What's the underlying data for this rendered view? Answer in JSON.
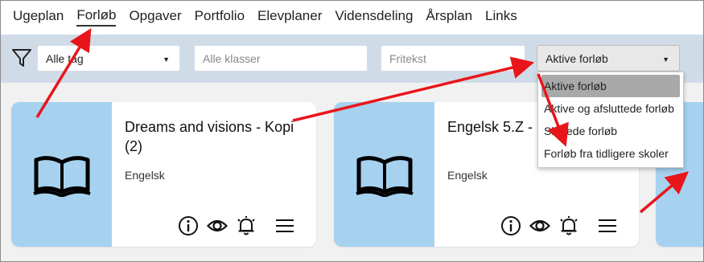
{
  "nav": {
    "items": [
      "Ugeplan",
      "Forløb",
      "Opgaver",
      "Portfolio",
      "Elevplaner",
      "Vidensdeling",
      "Årsplan",
      "Links"
    ],
    "active_index": 1
  },
  "filters": {
    "tags_select": "Alle tag",
    "classes_placeholder": "Alle klasser",
    "freetext_placeholder": "Fritekst",
    "status_select": "Aktive forløb"
  },
  "dropdown": {
    "options": [
      "Aktive forløb",
      "Aktive og afsluttede forløb",
      "Slettede forløb",
      "Forløb fra tidligere skoler"
    ],
    "selected_index": 0
  },
  "cards": [
    {
      "title": "Dreams and visions - Kopi (2)",
      "subject": "Engelsk"
    },
    {
      "title": "Engelsk 5.Z -",
      "subject": "Engelsk"
    }
  ],
  "colors": {
    "filter_bar": "#cfdce8",
    "card_thumb": "#a6d1ef",
    "annotation_arrow": "#e8161b"
  },
  "icons": {
    "filter": "funnel-icon",
    "card_thumb": "book-icon",
    "info": "info-icon",
    "view": "eye-icon",
    "notify": "bell-icon",
    "menu": "hamburger-icon"
  }
}
